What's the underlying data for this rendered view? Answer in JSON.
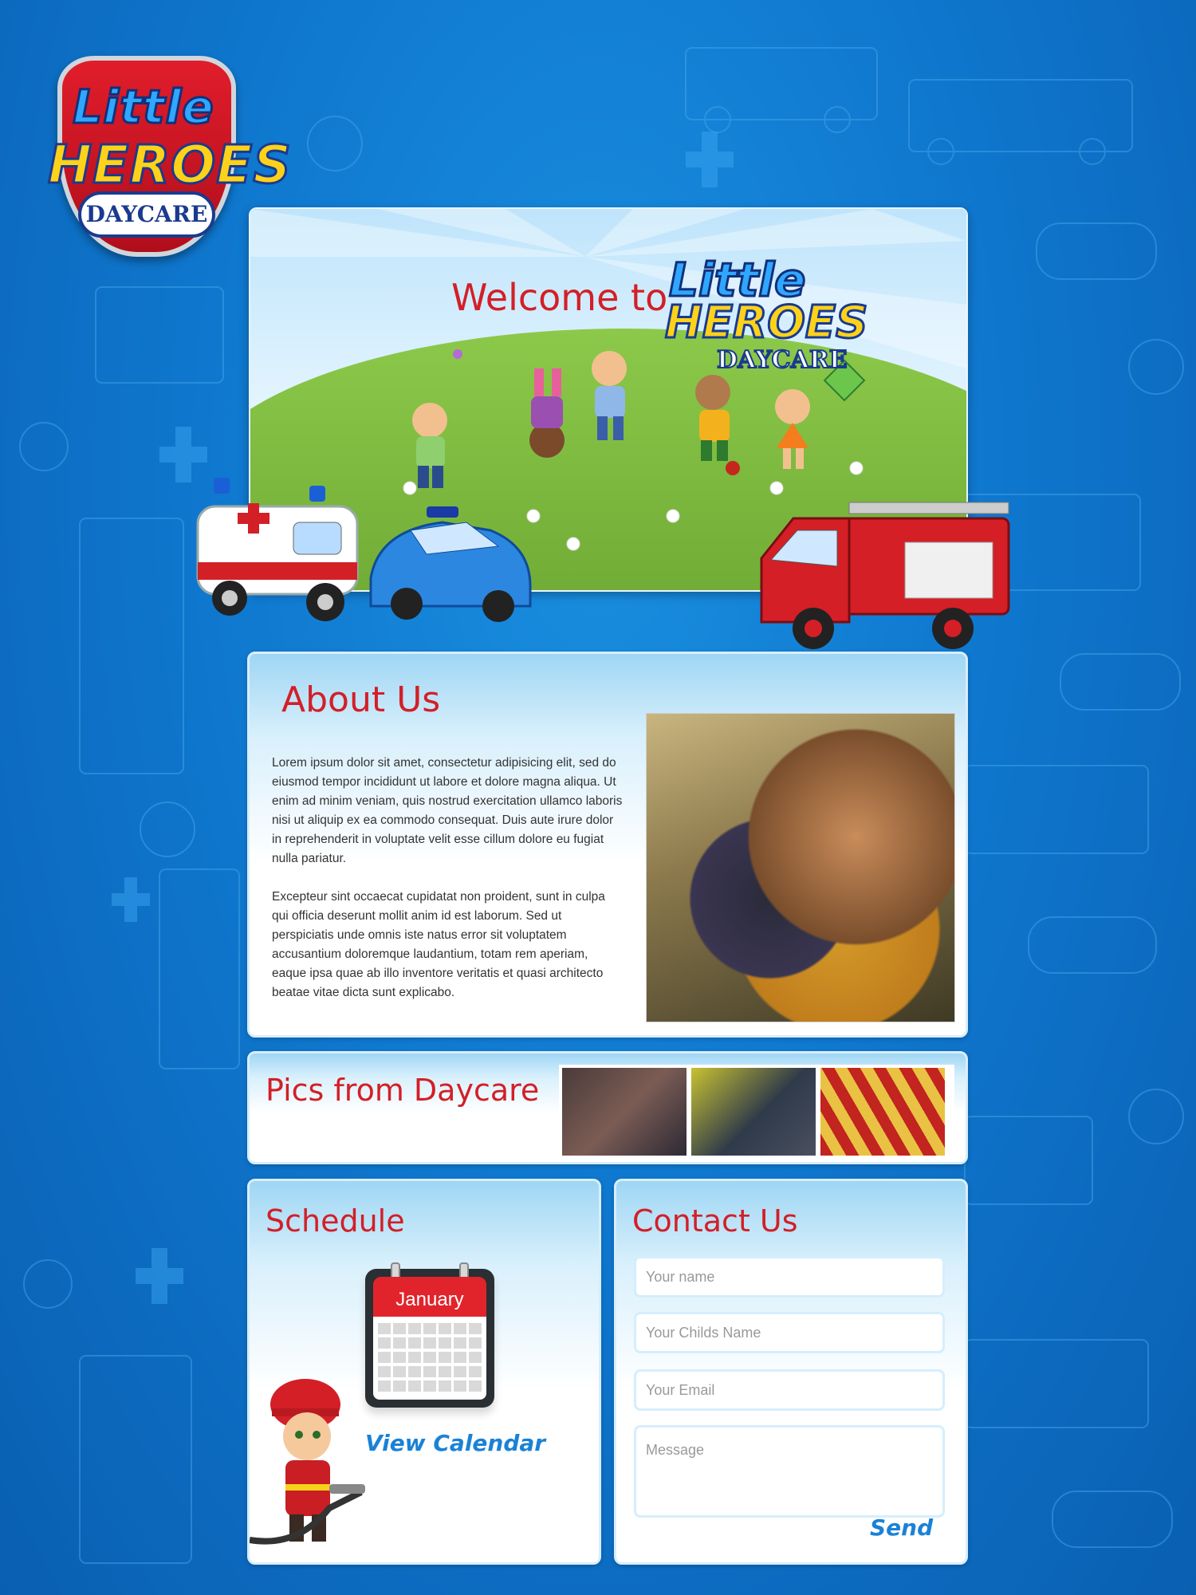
{
  "logo": {
    "line1": "Little",
    "line2": "HEROES",
    "line3": "DAYCARE"
  },
  "hero": {
    "welcome": "Welcome to",
    "logo_line1": "Little",
    "logo_line2": "HEROES",
    "logo_line3": "DAYCARE"
  },
  "about": {
    "title": "About Us",
    "paragraph1": "Lorem ipsum dolor sit amet, consectetur adipisicing elit, sed do eiusmod tempor incididunt ut labore et dolore magna aliqua. Ut enim ad minim veniam, quis nostrud exercitation ullamco laboris nisi ut aliquip ex ea commodo consequat. Duis aute irure dolor in reprehenderit in voluptate velit esse cillum dolore eu fugiat nulla pariatur.",
    "paragraph2": "Excepteur sint occaecat cupidatat non proident, sunt in culpa qui officia deserunt mollit anim id est laborum. Sed ut perspiciatis unde omnis iste natus error sit voluptatem accusantium doloremque laudantium, totam rem aperiam, eaque ipsa quae ab illo inventore veritatis et quasi architecto beatae vitae dicta sunt explicabo."
  },
  "pics": {
    "title": "Pics from Daycare"
  },
  "schedule": {
    "title": "Schedule",
    "calendar_month": "January",
    "view_calendar": "View Calendar"
  },
  "contact": {
    "title": "Contact Us",
    "name_placeholder": "Your name",
    "child_placeholder": "Your Childs Name",
    "email_placeholder": "Your Email",
    "message_placeholder": "Message",
    "send_label": "Send"
  },
  "colors": {
    "title_red": "#d31f27",
    "accent_blue": "#1a82d6",
    "background_blue": "#0f78cf"
  }
}
